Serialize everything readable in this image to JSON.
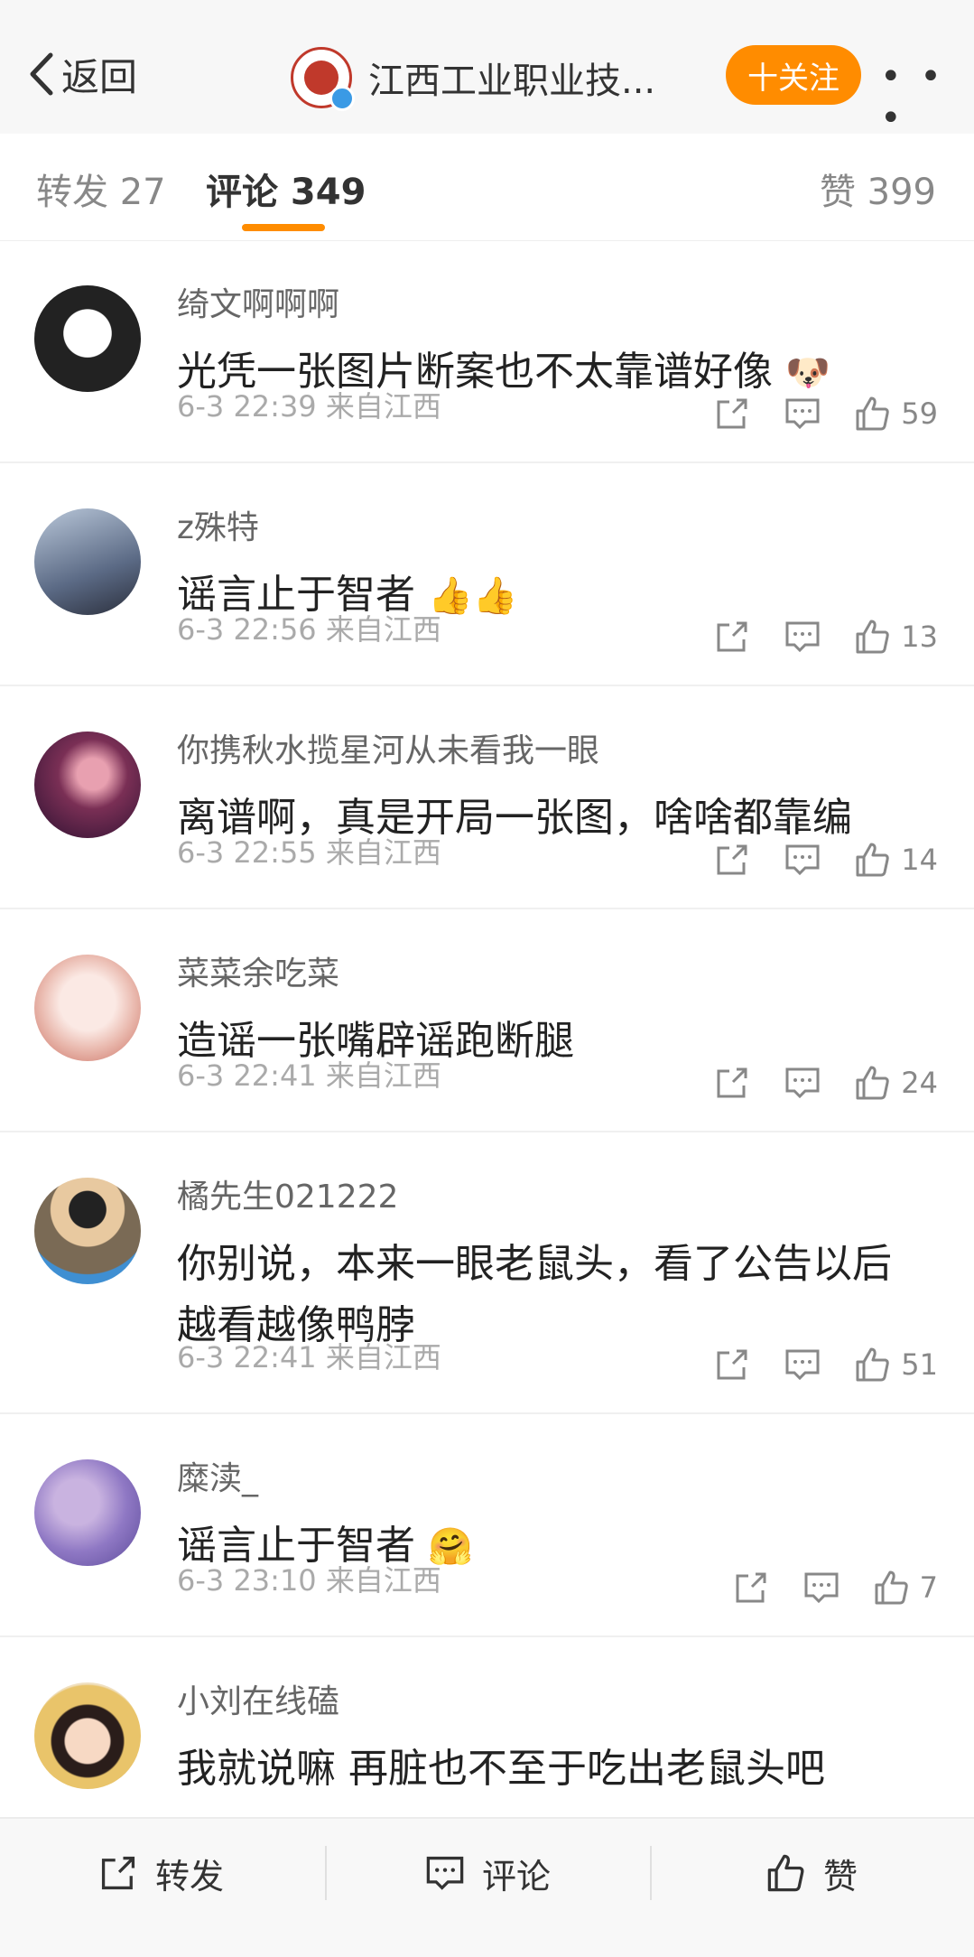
{
  "header": {
    "back_label": "返回",
    "title": "江西工业职业技...",
    "follow_label": "十关注",
    "more_label": "• • •"
  },
  "tabs": {
    "repost": "转发 27",
    "comment": "评论 349",
    "like": "赞 399"
  },
  "comments": [
    {
      "user": "绮文啊啊啊",
      "text": "光凭一张图片断案也不太靠谱好像",
      "emoji": "🐶",
      "meta": "6-3 22:39 来自江西",
      "likes": "59"
    },
    {
      "user": "z殊特",
      "text": "谣言止于智者",
      "emoji": "👍👍",
      "meta": "6-3 22:56 来自江西",
      "likes": "13"
    },
    {
      "user": "你携秋水揽星河从未看我一眼",
      "text": "离谱啊，真是开局一张图，啥啥都靠编",
      "emoji": "",
      "meta": "6-3 22:55 来自江西",
      "likes": "14"
    },
    {
      "user": "菜菜余吃菜",
      "text": "造谣一张嘴辟谣跑断腿",
      "emoji": "",
      "meta": "6-3 22:41 来自江西",
      "likes": "24"
    },
    {
      "user": "橘先生021222",
      "text": "你别说，本来一眼老鼠头，看了公告以后越看越像鸭脖",
      "emoji": "",
      "meta": "6-3 22:41 来自江西",
      "likes": "51"
    },
    {
      "user": "糜渎_",
      "text": "谣言止于智者",
      "emoji": "🤗",
      "meta": "6-3 23:10 来自江西",
      "likes": "7"
    },
    {
      "user": "小刘在线磕",
      "text": "我就说嘛 再脏也不至于吃出老鼠头吧",
      "emoji": "",
      "meta": "",
      "likes": ""
    }
  ],
  "bottom_bar": {
    "repost_label": "转发",
    "comment_label": "评论",
    "like_label": "赞"
  },
  "colors": {
    "accent": "#ff8c00",
    "text_primary": "#222222",
    "text_secondary": "#888888"
  }
}
